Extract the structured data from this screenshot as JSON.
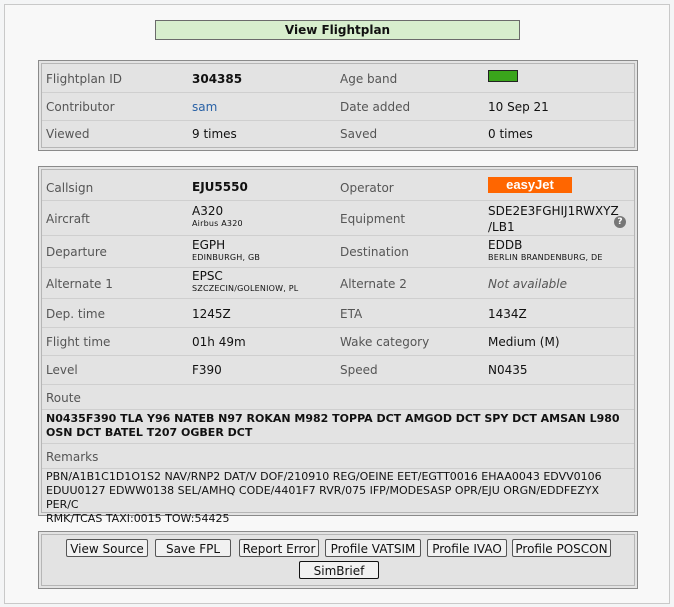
{
  "title": "View Flightplan",
  "summary": {
    "flightplan_id": {
      "label": "Flightplan ID",
      "value": "304385"
    },
    "age_band": {
      "label": "Age band",
      "color": "#3aa51b"
    },
    "contributor": {
      "label": "Contributor",
      "value": "sam"
    },
    "date_added": {
      "label": "Date added",
      "value": "10 Sep 21"
    },
    "viewed": {
      "label": "Viewed",
      "value": "9 times"
    },
    "saved": {
      "label": "Saved",
      "value": "0 times"
    }
  },
  "details": {
    "callsign": {
      "label": "Callsign",
      "value": "EJU5550"
    },
    "operator": {
      "label": "Operator",
      "logo_text": "easyJet",
      "logo_color": "#ff6600"
    },
    "aircraft": {
      "label": "Aircraft",
      "value": "A320",
      "sub": "Airbus A320"
    },
    "equipment": {
      "label": "Equipment",
      "value_line1": "SDE2E3FGHIJ1RWXYZ",
      "value_line2": "/LB1",
      "help_icon": "question-circle-icon"
    },
    "departure": {
      "label": "Departure",
      "value": "EGPH",
      "sub": "EDINBURGH, GB"
    },
    "destination": {
      "label": "Destination",
      "value": "EDDB",
      "sub": "BERLIN BRANDENBURG, DE"
    },
    "alternate1": {
      "label": "Alternate 1",
      "value": "EPSC",
      "sub": "SZCZECIN/GOLENIOW, PL"
    },
    "alternate2": {
      "label": "Alternate 2",
      "value": "Not available"
    },
    "dep_time": {
      "label": "Dep. time",
      "value": "1245Z"
    },
    "eta": {
      "label": "ETA",
      "value": "1434Z"
    },
    "flight_time": {
      "label": "Flight time",
      "value": "01h 49m"
    },
    "wake_category": {
      "label": "Wake category",
      "value": "Medium (M)"
    },
    "level": {
      "label": "Level",
      "value": "F390"
    },
    "speed": {
      "label": "Speed",
      "value": "N0435"
    },
    "route_label": "Route",
    "route_line1": "N0435F390 TLA Y96 NATEB N97 ROKAN M982 TOPPA DCT AMGOD DCT SPY DCT AMSAN L980",
    "route_line2": "OSN DCT BATEL T207 OGBER DCT",
    "remarks_label": "Remarks",
    "remarks_line1": "PBN/A1B1C1D1O1S2 NAV/RNP2 DAT/V DOF/210910 REG/OEINE EET/EGTT0016 EHAA0043 EDVV0106",
    "remarks_line2": "EDUU0127 EDWW0138 SEL/AMHQ CODE/4401F7 RVR/075 IFP/MODESASP OPR/EJU ORGN/EDDFEZYX PER/C",
    "remarks_line3": "RMK/TCAS TAXI:0015 TOW:54425"
  },
  "actions": {
    "view_source": "View Source",
    "save_fpl": "Save FPL",
    "report_error": "Report Error",
    "profile_vatsim": "Profile VATSIM",
    "profile_ivao": "Profile IVAO",
    "profile_poscon": "Profile POSCON",
    "simbrief": "SimBrief"
  }
}
